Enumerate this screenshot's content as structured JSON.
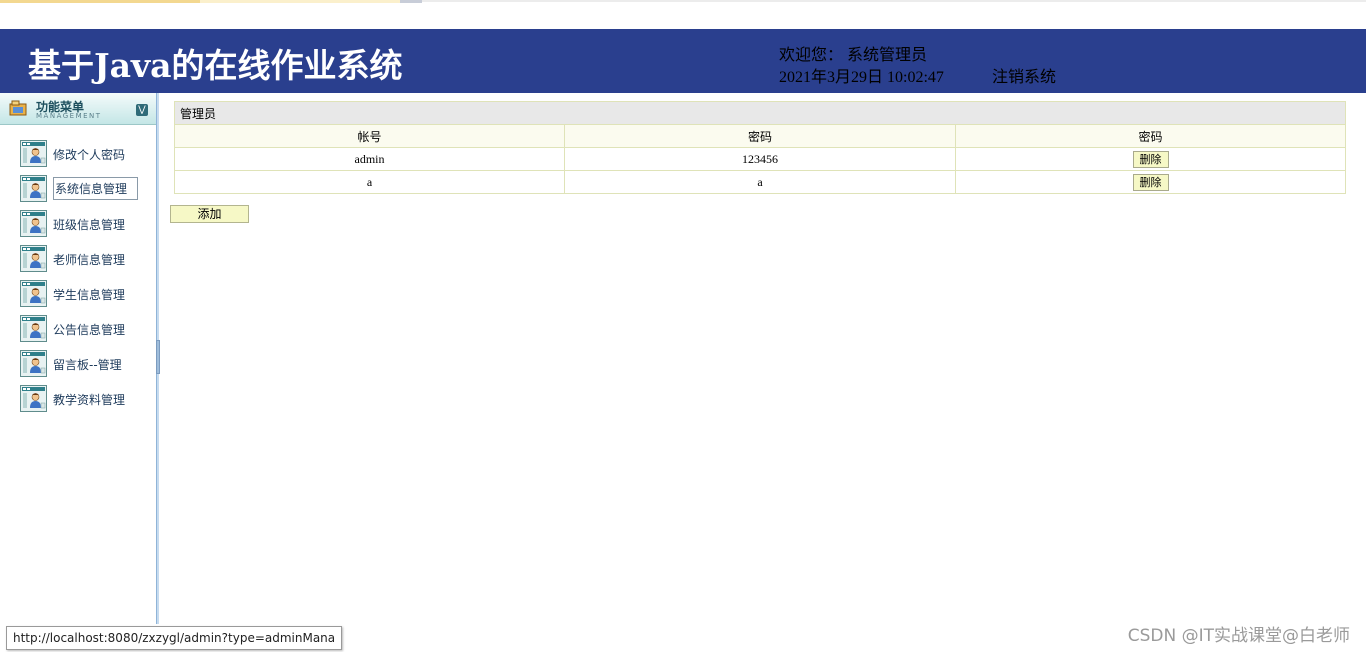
{
  "header": {
    "site_title": "基于Java的在线作业系统",
    "welcome_label": "欢迎您：",
    "user_name": "系统管理员",
    "datetime": "2021年3月29日 10:02:47",
    "logout_label": "注销系统",
    "banner_color": "#2a3f8e"
  },
  "sidebar": {
    "menu_title": "功能菜单",
    "menu_subtitle": "MANAGEMENT",
    "items": [
      {
        "label": "修改个人密码",
        "icon": "user-card-icon"
      },
      {
        "label": "系统信息管理",
        "icon": "user-card-icon",
        "active": true
      },
      {
        "label": "班级信息管理",
        "icon": "user-card-icon"
      },
      {
        "label": "老师信息管理",
        "icon": "user-card-icon"
      },
      {
        "label": "学生信息管理",
        "icon": "user-card-icon"
      },
      {
        "label": "公告信息管理",
        "icon": "user-card-icon"
      },
      {
        "label": "留言板--管理",
        "icon": "user-card-icon"
      },
      {
        "label": "教学资料管理",
        "icon": "user-card-icon"
      }
    ]
  },
  "table": {
    "caption": "管理员",
    "columns": [
      "帐号",
      "密码",
      "密码"
    ],
    "rows": [
      {
        "account": "admin",
        "password": "123456",
        "action": "删除"
      },
      {
        "account": "a",
        "password": "a",
        "action": "删除"
      }
    ]
  },
  "add_button": "添加",
  "status_bar": "http://localhost:8080/zxzygl/admin?type=adminMana",
  "watermark": "CSDN @IT实战课堂@白老师"
}
